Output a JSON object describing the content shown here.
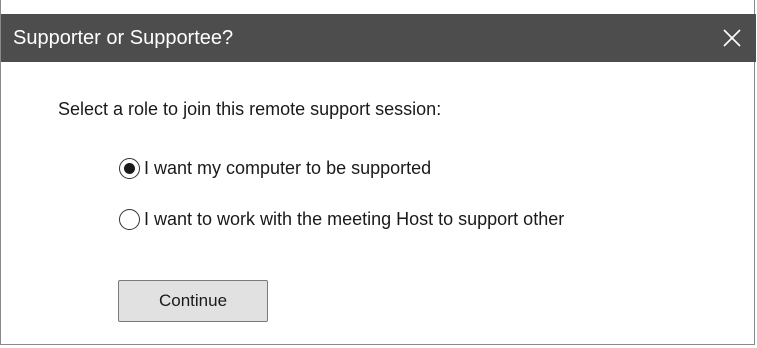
{
  "dialog": {
    "title": "Supporter or Supportee?",
    "close_icon": "close-icon",
    "prompt": "Select a role to join this remote support session:",
    "options": [
      {
        "label": "I want my computer to be supported",
        "selected": true
      },
      {
        "label": "I want to work with the meeting Host to support other",
        "selected": false
      }
    ],
    "continue_label": "Continue"
  },
  "colors": {
    "titlebar_bg": "#4d4d4d",
    "titlebar_text": "#ffffff",
    "button_bg": "#e1e1e1"
  }
}
